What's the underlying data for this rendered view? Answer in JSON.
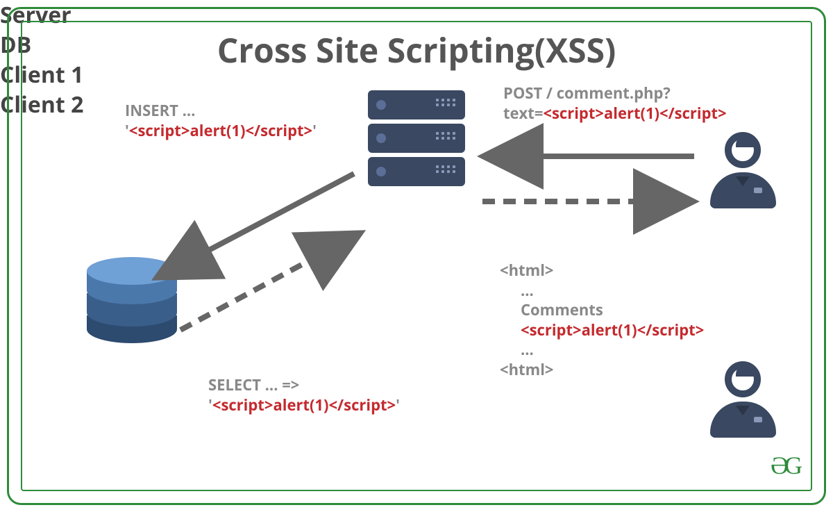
{
  "title": "Cross Site Scripting(XSS)",
  "nodes": {
    "server": "Server",
    "db": "DB",
    "client1": "Client 1",
    "client2": "Client 2"
  },
  "insert": {
    "line1": "INSERT ...",
    "q_open": "'",
    "payload": "<script>alert(1)</script>",
    "q_close": "'"
  },
  "post": {
    "line1": "POST / comment.php?",
    "prefix": "text=",
    "payload": "<script>alert(1)</script>"
  },
  "select": {
    "line1": "SELECT ... =>",
    "q_open": "'",
    "payload": "<script>alert(1)</script>",
    "q_close": "'"
  },
  "response": {
    "open_tag": "<html>",
    "dots1": "...",
    "comments": "Comments",
    "payload": "<script>alert(1)</script>",
    "dots2": "...",
    "close_tag": "<html>"
  },
  "logo": "ƏG",
  "colors": {
    "border": "#2e8b3b",
    "text": "#555",
    "red": "#c42a2e",
    "gray": "#888",
    "dark": "#3a4861"
  }
}
